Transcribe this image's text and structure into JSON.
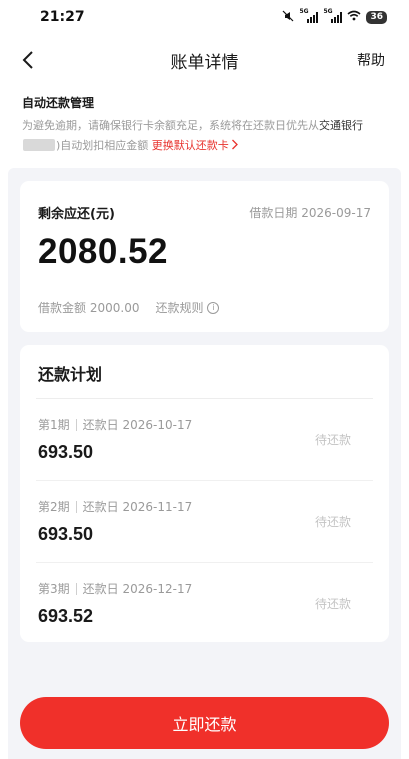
{
  "status_bar": {
    "time": "21:27",
    "network_1": "5G",
    "network_2": "5G",
    "battery": "36"
  },
  "nav": {
    "title": "账单详情",
    "help_label": "帮助"
  },
  "notice": {
    "title": "自动还款管理",
    "text_before": "为避免逾期，请确保银行卡余额充足，系统将在还款日优先从",
    "bank_prefix": "交通银行",
    "text_after": ")自动划扣相应金额",
    "link_label": "更换默认还款卡"
  },
  "summary": {
    "remaining_label": "剩余应还(元)",
    "borrow_date_label": "借款日期",
    "borrow_date": "2026-09-17",
    "remaining_amount": "2080.52",
    "loan_amount_label": "借款金额",
    "loan_amount": "2000.00",
    "rules_label": "还款规则"
  },
  "plan": {
    "title": "还款计划",
    "rows": [
      {
        "period": "第1期",
        "due_label": "还款日",
        "due_date": "2026-10-17",
        "amount": "693.50",
        "status": "待还款"
      },
      {
        "period": "第2期",
        "due_label": "还款日",
        "due_date": "2026-11-17",
        "amount": "693.50",
        "status": "待还款"
      },
      {
        "period": "第3期",
        "due_label": "还款日",
        "due_date": "2026-12-17",
        "amount": "693.52",
        "status": "待还款"
      }
    ]
  },
  "pay_button": {
    "label": "立即还款"
  },
  "colors": {
    "accent": "#f0302a",
    "background": "#f3f4f8"
  },
  "icons": {
    "back": "chevron-left-icon",
    "info": "info-icon",
    "link_arrow": "chevron-right-icon"
  }
}
